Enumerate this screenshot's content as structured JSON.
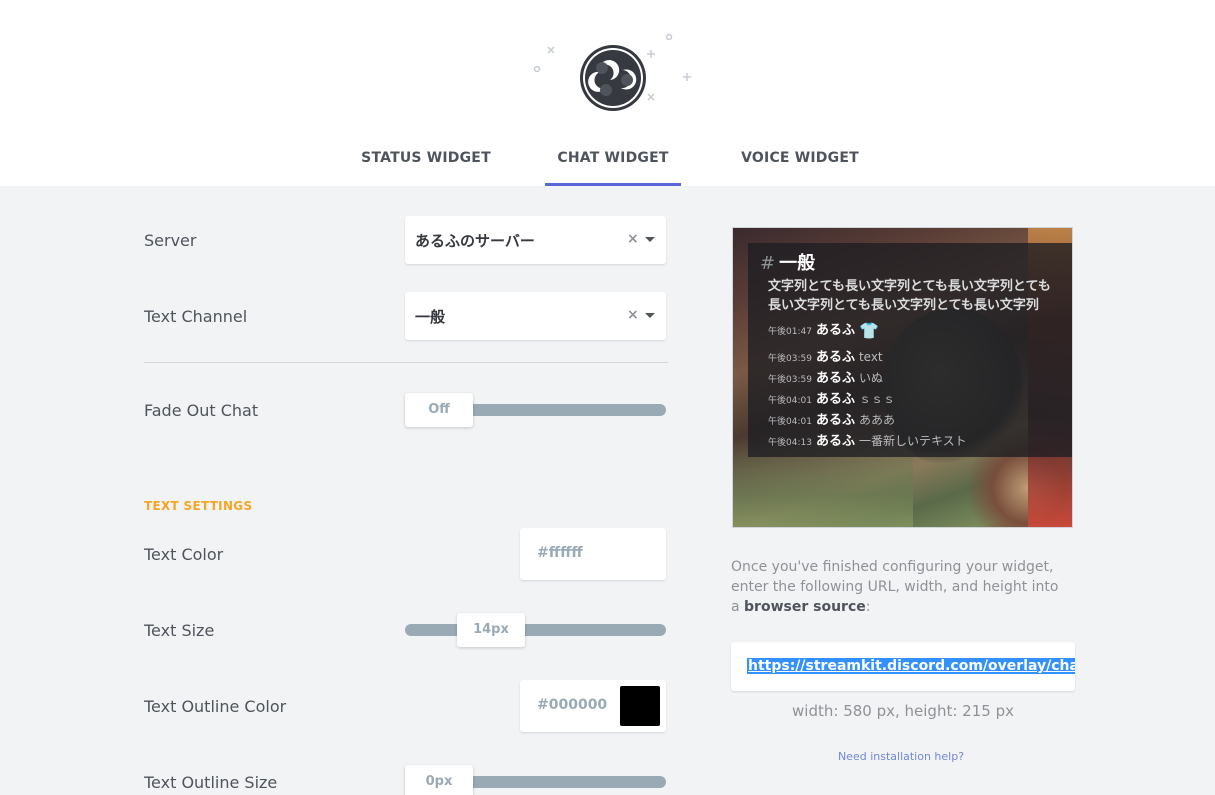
{
  "tabs": [
    {
      "label": "STATUS WIDGET"
    },
    {
      "label": "CHAT WIDGET"
    },
    {
      "label": "VOICE WIDGET"
    }
  ],
  "active_tab": "CHAT WIDGET",
  "colors": {
    "accent": "#5b67d8",
    "section_head": "#f5a623",
    "link": "#7289da",
    "selection": "#3390ff"
  },
  "form": {
    "server": {
      "label": "Server",
      "value": "あるふのサーバー",
      "clear": "×"
    },
    "text_channel": {
      "label": "Text Channel",
      "value": "一般",
      "clear": "×"
    },
    "fade_out": {
      "label": "Fade Out Chat",
      "value": "Off"
    },
    "text_settings_heading": "TEXT SETTINGS",
    "text_color": {
      "label": "Text Color",
      "value": "#ffffff"
    },
    "text_size": {
      "label": "Text Size",
      "value": "14px"
    },
    "text_outline_color": {
      "label": "Text Outline Color",
      "value": "#000000",
      "swatch": "#000000"
    },
    "text_outline_size": {
      "label": "Text Outline Size",
      "value": "0px"
    }
  },
  "preview": {
    "hash": "#",
    "channel": "一般",
    "long_text_1": "文字列とても長い文字列とても長い文字列とても",
    "long_text_2": "長い文字列とても長い文字列とても長い文字列",
    "messages": [
      {
        "time": "午後01:47",
        "name": "あるふ",
        "body": "",
        "icon": "shirt-emoji"
      },
      {
        "time": "午後03:59",
        "name": "あるふ",
        "body": "text"
      },
      {
        "time": "午後03:59",
        "name": "あるふ",
        "body": "いぬ"
      },
      {
        "time": "午後04:01",
        "name": "あるふ",
        "body": "ｓｓｓ"
      },
      {
        "time": "午後04:01",
        "name": "あるふ",
        "body": "あああ"
      },
      {
        "time": "午後04:13",
        "name": "あるふ",
        "body": "一番新しいテキスト"
      }
    ]
  },
  "info": {
    "line1": "Once you've finished configuring your widget,",
    "line2": "enter the following URL, width, and height into",
    "line3_prefix": "a ",
    "line3_bold": "browser source",
    "line3_suffix": ":"
  },
  "url": "https://streamkit.discord.com/overlay/chat/",
  "dims": "width: 580 px, height: 215 px",
  "help": "Need installation help?"
}
